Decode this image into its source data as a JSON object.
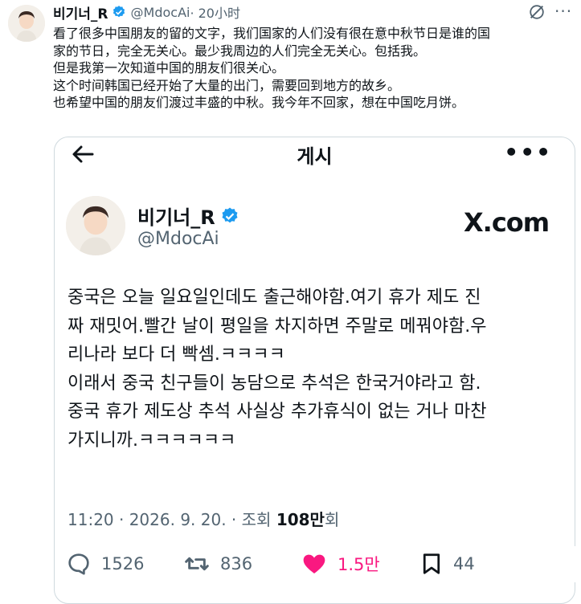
{
  "tweet": {
    "author_name": "비기너_R",
    "author_handle": "@MdocAi",
    "time": "· 20小时",
    "icons": {
      "verified": "verified-badge-icon",
      "grok": "grok-icon",
      "more": "more-icon"
    },
    "body_lines": [
      "看了很多中国朋友的留的文字，我们国家的人们没有很在意中秋节日是谁的国",
      "家的节日，完全无关心。最少我周边的人们完全无关心。包括我。",
      "但是我第一次知道中国的朋友们很关心。",
      "这个时间韩国已经开始了大量的出门，需要回到地方的故乡。",
      "也希望中国的朋友们渡过丰盛的中秋。我今年不回家，想在中国吃月饼。"
    ]
  },
  "embedded": {
    "header_title": "게시",
    "author_name": "비기너_R",
    "author_handle": "@MdocAi",
    "site_logo": "X.com",
    "text_lines": [
      "중국은 오늘 일요일인데도 출근해야함.여기 휴가 제도 진",
      "짜 재밋어.빨간 날이 평일을 차지하면 주말로 메꿔야함.우",
      "리나라 보다 더 빡셈.ㅋㅋㅋㅋ",
      "이래서 중국 친구들이 농담으로 추석은 한국거야라고 함.",
      "중국 휴가 제도상 추석 사실상 추가휴식이 없는 거나 마찬",
      "가지니까.ㅋㅋㅋㅋㅋㅋ"
    ],
    "meta_prefix": "11:20 · 2026. 9. 20. · 조회 ",
    "views": "108만",
    "views_suffix": "회",
    "actions": {
      "replies": "1526",
      "reposts": "836",
      "likes": "1.5만",
      "bookmarks": "44"
    },
    "colors": {
      "like": "#f91880",
      "verified": "#1d9bf0",
      "muted": "#536471"
    }
  }
}
